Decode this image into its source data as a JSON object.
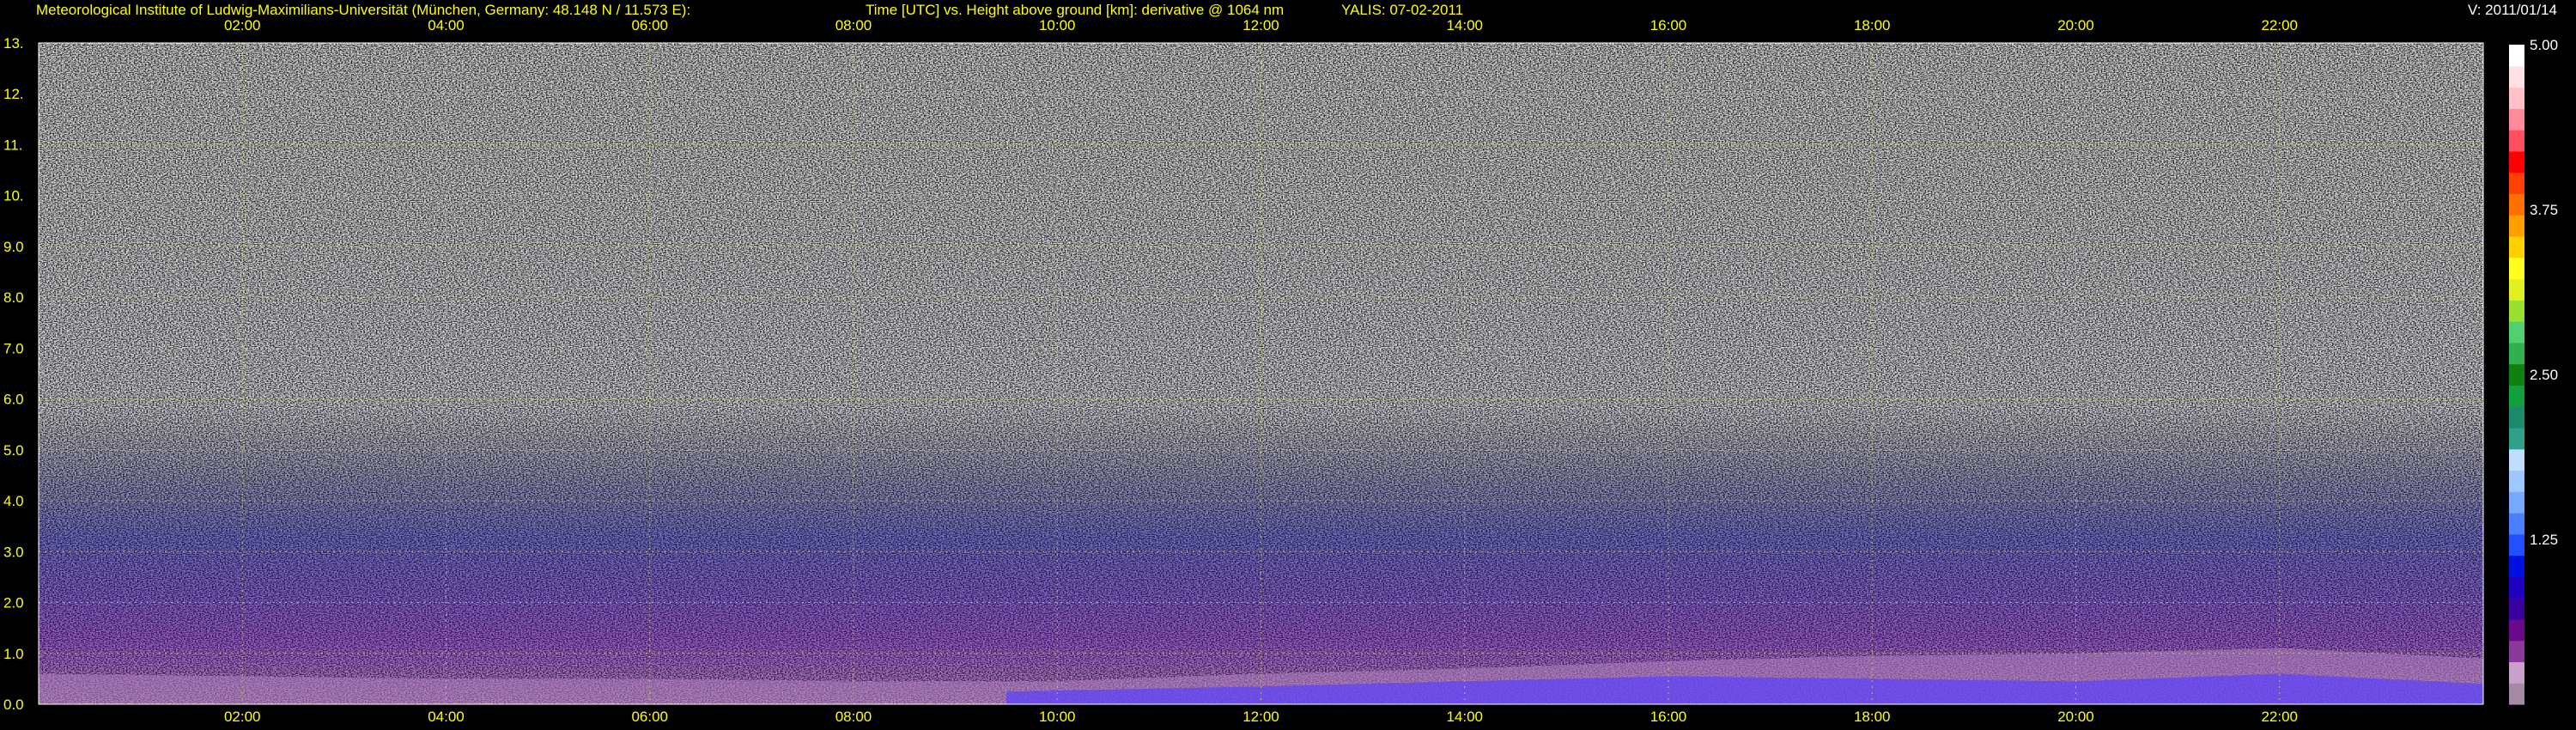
{
  "header": {
    "institute": "Meteorological Institute of Ludwig-Maximilians-Universität (München, Germany: 48.148 N / 11.573 E):",
    "title": "Time [UTC] vs. Height above ground [km]: derivative @ 1064 nm",
    "instrument_date": "YALIS: 07-02-2011",
    "version": "V: 2011/01/14"
  },
  "chart_data": {
    "type": "heatmap",
    "title": "Time [UTC] vs. Height above ground [km]: derivative @ 1064 nm",
    "xlabel": "Time [UTC]",
    "ylabel": "Height above ground [km]",
    "x_range_hours": [
      0,
      24
    ],
    "y_range_km": [
      0,
      13
    ],
    "x_ticks": [
      "02:00",
      "04:00",
      "06:00",
      "08:00",
      "10:00",
      "12:00",
      "14:00",
      "16:00",
      "18:00",
      "20:00",
      "22:00"
    ],
    "x_tick_hours": [
      2,
      4,
      6,
      8,
      10,
      12,
      14,
      16,
      18,
      20,
      22
    ],
    "y_ticks": [
      "0.0",
      "1.0",
      "2.0",
      "3.0",
      "4.0",
      "5.0",
      "6.0",
      "7.0",
      "8.0",
      "9.0",
      "10.",
      "11.",
      "12.",
      "13."
    ],
    "y_tick_values": [
      0,
      1,
      2,
      3,
      4,
      5,
      6,
      7,
      8,
      9,
      10,
      11,
      12,
      13
    ],
    "grid": true,
    "colorbar": {
      "ticks": [
        "1.25",
        "2.50",
        "3.75",
        "5.00"
      ],
      "tick_values": [
        1.25,
        2.5,
        3.75,
        5.0
      ],
      "range": [
        0,
        5.0
      ],
      "colors": [
        "#a58aa5",
        "#c9a0c9",
        "#8a3a9a",
        "#6a0a8a",
        "#3a00a0",
        "#2000c0",
        "#0010e0",
        "#2050ff",
        "#4a80ff",
        "#78a8ff",
        "#9ec6ff",
        "#c0dcff",
        "#2fa08a",
        "#1a8a6a",
        "#10a040",
        "#108010",
        "#30b050",
        "#50d070",
        "#9ae030",
        "#e0f020",
        "#ffff20",
        "#ffd000",
        "#ffa000",
        "#ff7000",
        "#ff4000",
        "#ff0000",
        "#ff5060",
        "#ff8a9a",
        "#ffc0c8",
        "#ffe0e4",
        "#ffffff"
      ]
    },
    "layers": [
      {
        "name": "boundary layer top",
        "x_hours": [
          0,
          2,
          4,
          6,
          8,
          10,
          12,
          14,
          16,
          18,
          20,
          22,
          24
        ],
        "height_km": [
          0.6,
          0.55,
          0.5,
          0.5,
          0.45,
          0.45,
          0.6,
          0.7,
          0.85,
          0.95,
          1.0,
          1.1,
          0.9
        ]
      },
      {
        "name": "aerosol layer",
        "x_hours": [
          9.5,
          12,
          14,
          16,
          18,
          20,
          22,
          24
        ],
        "height_km": [
          0.25,
          0.35,
          0.45,
          0.55,
          0.5,
          0.45,
          0.6,
          0.4
        ]
      }
    ]
  }
}
